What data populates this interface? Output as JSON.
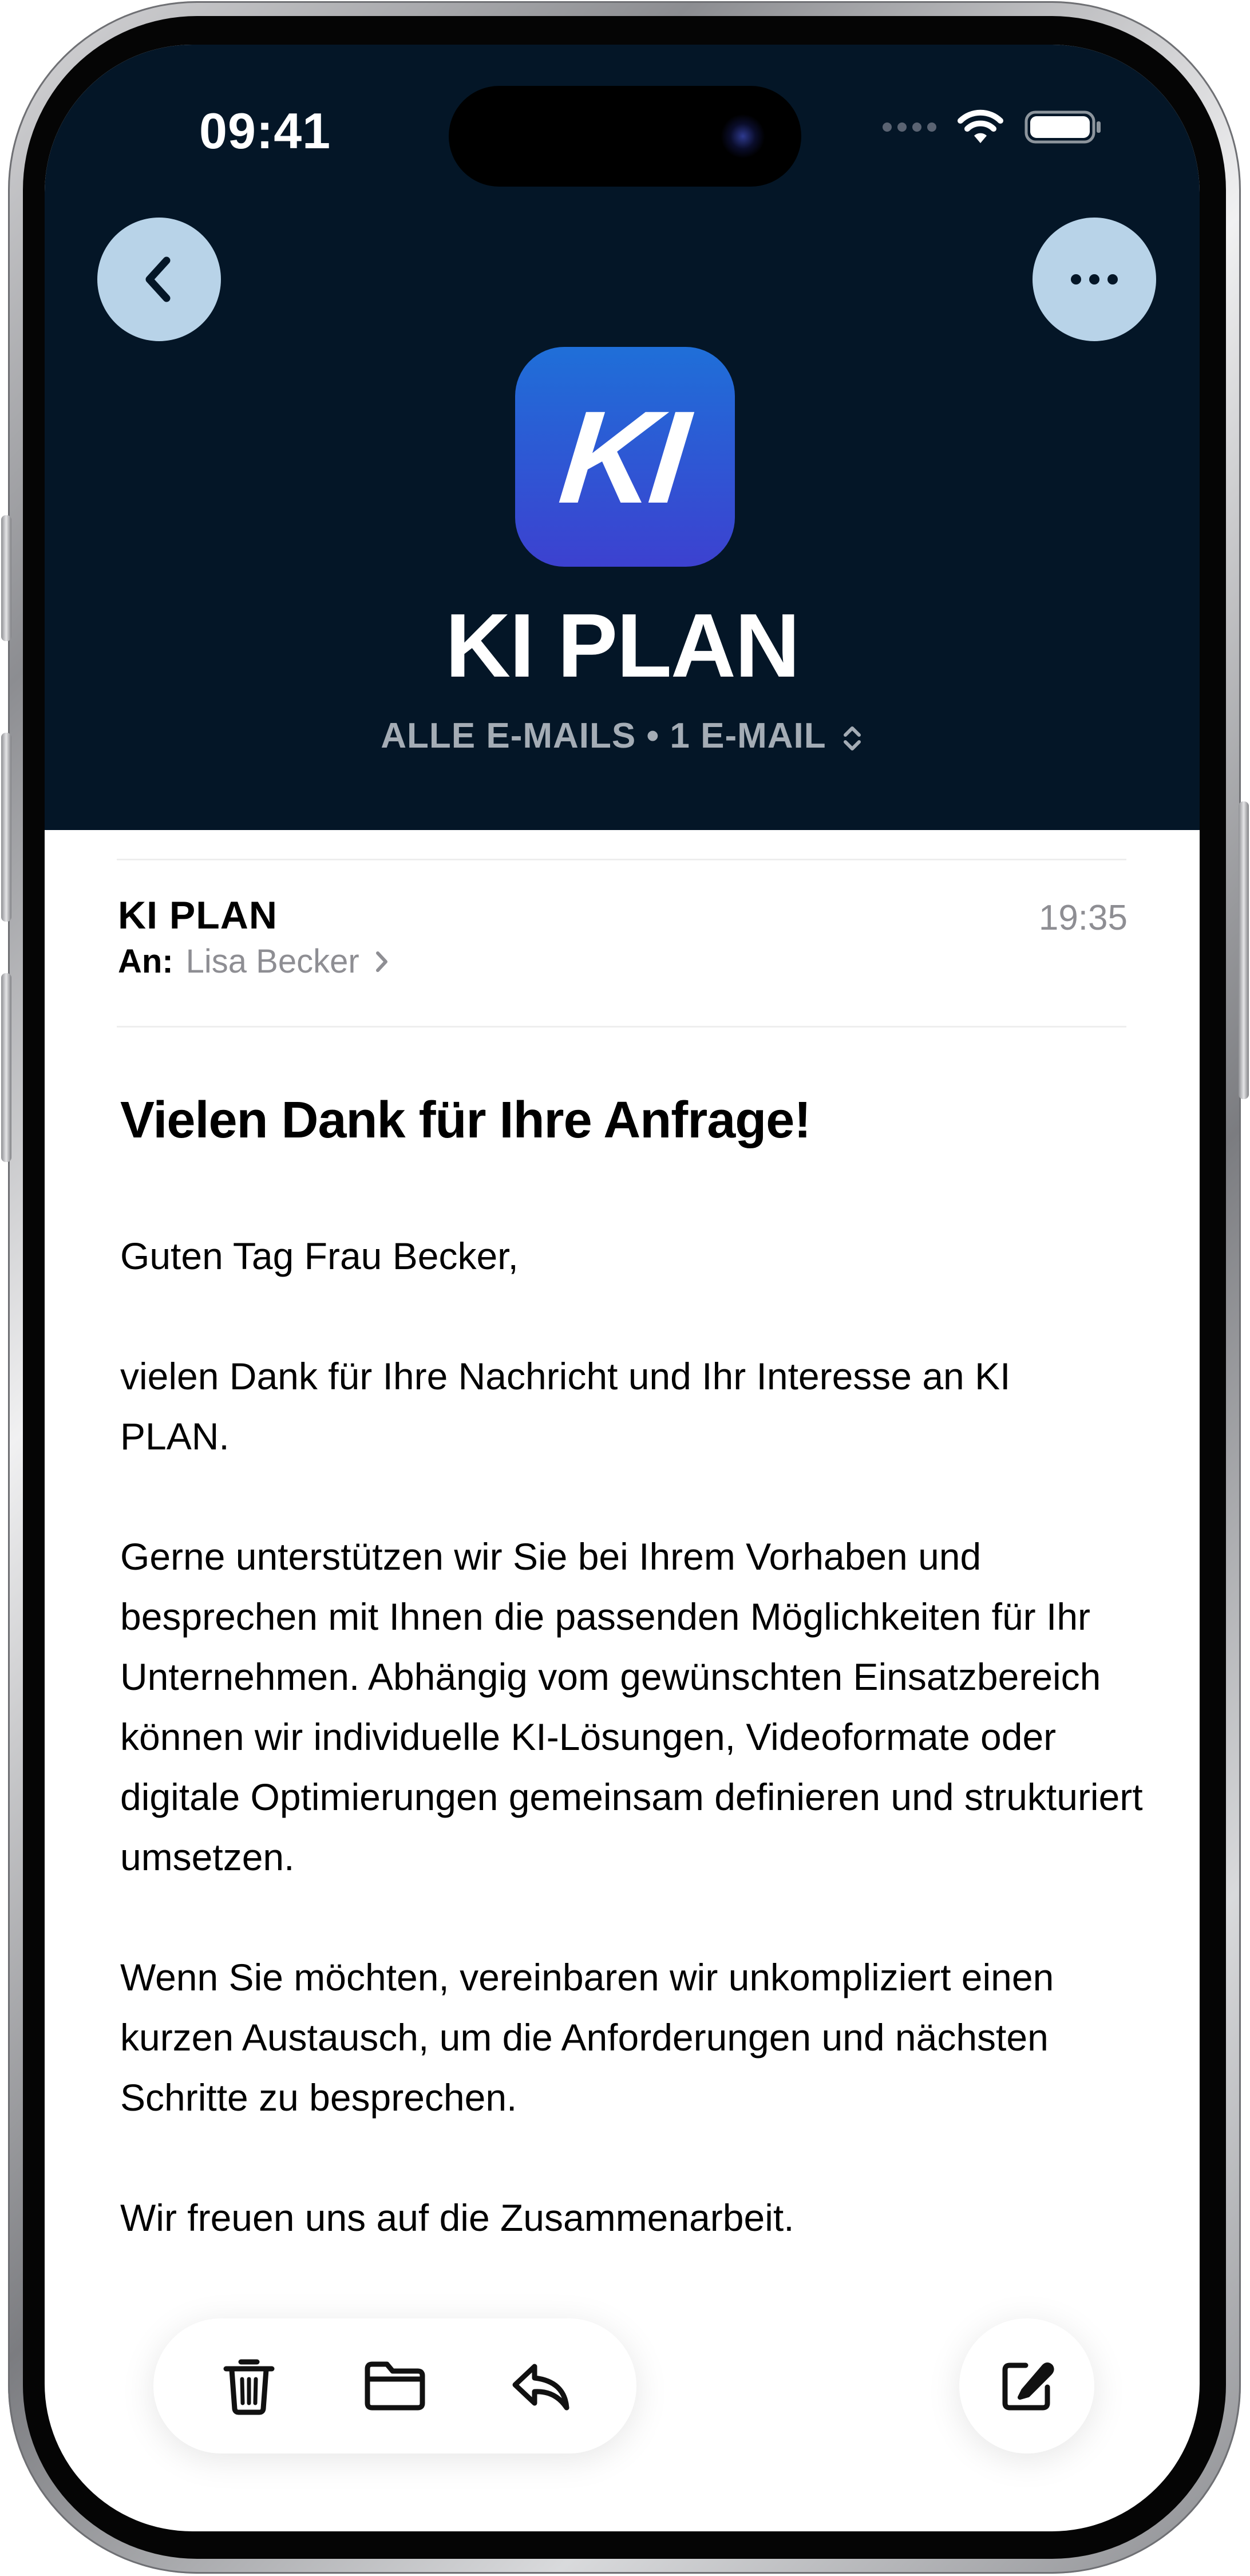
{
  "status_bar": {
    "time": "09:41"
  },
  "header": {
    "logo_text": "KI",
    "sender_title": "KI PLAN",
    "mailbox_label": "ALLE E-MAILS • 1 E-MAIL",
    "back_icon": "chevron-left-icon",
    "more_icon": "ellipsis-icon",
    "background_color": "#041627",
    "button_color": "#b8d3e8"
  },
  "mail": {
    "from": "KI PLAN",
    "time": "19:35",
    "to_label": "An:",
    "to_name": "Lisa Becker",
    "subject": "Vielen Dank für Ihre Anfrage!",
    "body": [
      "Guten Tag Frau Becker,",
      "vielen Dank für Ihre Nachricht und Ihr Interesse an KI PLAN.",
      "Gerne unterstützen wir Sie bei Ihrem Vorhaben und besprechen mit Ihnen die passenden Möglichkeiten für Ihr Unternehmen. Abhängig vom gewünschten Einsatzbereich können wir individuelle KI-Lösungen, Videoformate oder digitale Optimierungen gemeinsam definieren und strukturiert umsetzen.",
      "Wenn Sie möchten, vereinbaren wir unkompliziert einen kurzen Austausch, um die Anforderungen und nächsten Schritte zu besprechen.",
      "Wir freuen uns auf die Zusammenarbeit."
    ]
  },
  "toolbar": {
    "items": [
      "trash-icon",
      "folder-icon",
      "reply-icon"
    ],
    "compose_icon": "compose-icon"
  }
}
